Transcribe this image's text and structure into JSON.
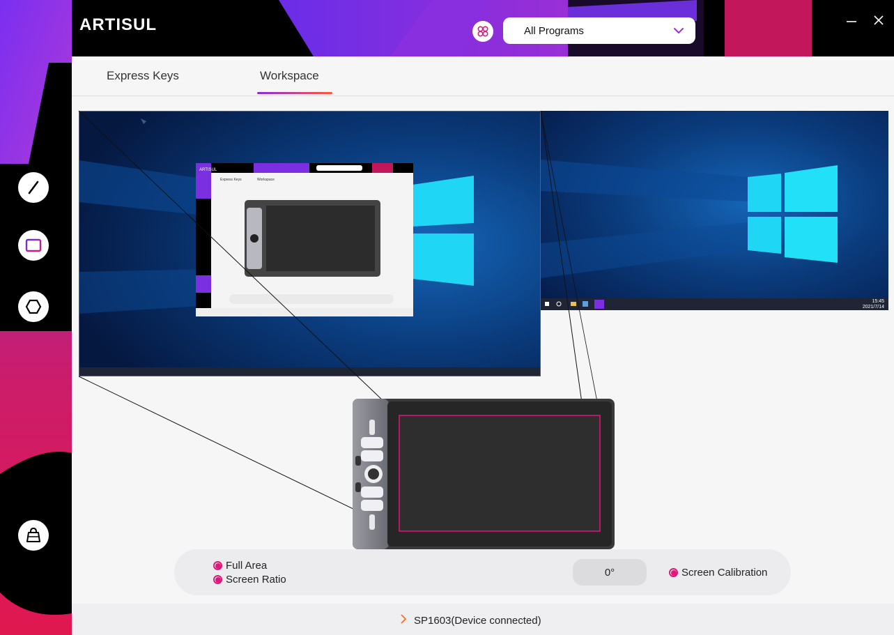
{
  "app": {
    "logo_text": "ARTISUL",
    "program_select": "All Programs"
  },
  "tabs": [
    {
      "label": "Express Keys",
      "active": false
    },
    {
      "label": "Workspace",
      "active": true
    }
  ],
  "nav": [
    "pen-settings-icon",
    "display-settings-icon",
    "shortcut-wheel-icon",
    "driver-store-icon"
  ],
  "monitors": {
    "secondary_taskbar_time": "15:45",
    "secondary_taskbar_date": "2021/7/14"
  },
  "mapping_options": {
    "full_area": "Full Area",
    "screen_ratio": "Screen Ratio",
    "rotation": "0°",
    "screen_calibration": "Screen Calibration"
  },
  "status": {
    "device": "SP1603(Device connected)"
  },
  "colors": {
    "accent": "#e0177a",
    "purple": "#7b2fe0",
    "black": "#000000"
  }
}
